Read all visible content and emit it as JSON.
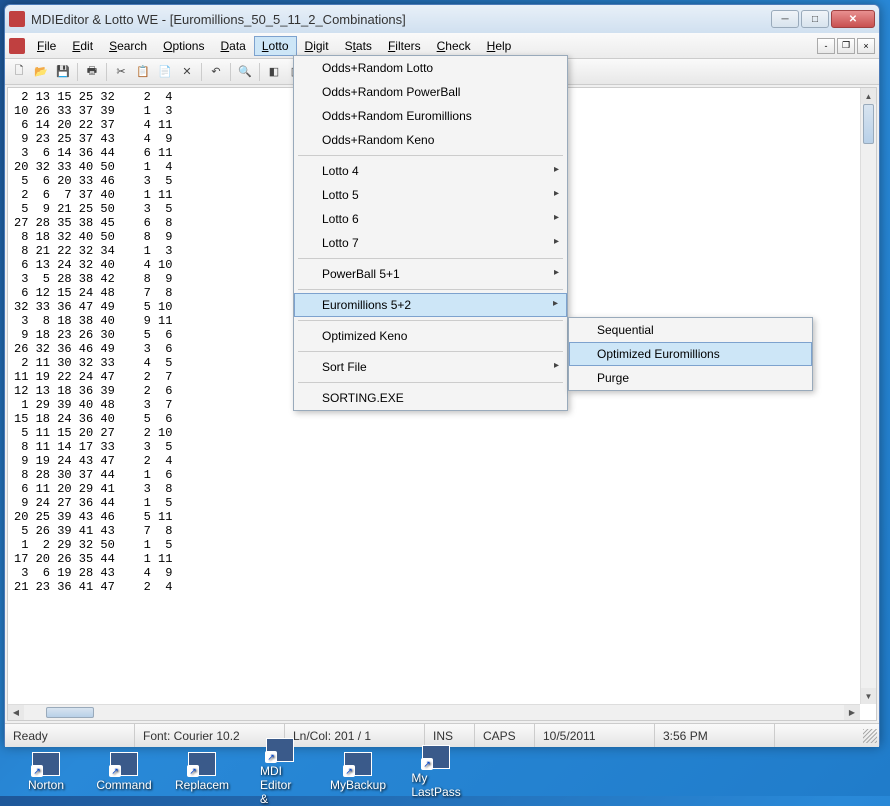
{
  "window": {
    "title": "MDIEditor & Lotto WE - [Euromillions_50_5_11_2_Combinations]"
  },
  "menubar": {
    "items": [
      "File",
      "Edit",
      "Search",
      "Options",
      "Data",
      "Lotto",
      "Digit",
      "Stats",
      "Filters",
      "Check",
      "Help"
    ],
    "active_index": 5
  },
  "dropdown_lotto": {
    "items": [
      {
        "label": "Odds+Random Lotto"
      },
      {
        "label": "Odds+Random PowerBall"
      },
      {
        "label": "Odds+Random Euromillions"
      },
      {
        "label": "Odds+Random Keno"
      },
      {
        "sep": true
      },
      {
        "label": "Lotto 4",
        "arrow": true
      },
      {
        "label": "Lotto 5",
        "arrow": true
      },
      {
        "label": "Lotto 6",
        "arrow": true
      },
      {
        "label": "Lotto 7",
        "arrow": true
      },
      {
        "sep": true
      },
      {
        "label": "PowerBall 5+1",
        "arrow": true
      },
      {
        "sep": true
      },
      {
        "label": "Euromillions 5+2",
        "arrow": true,
        "highlight": true
      },
      {
        "sep": true
      },
      {
        "label": "Optimized Keno"
      },
      {
        "sep": true
      },
      {
        "label": "Sort File",
        "arrow": true
      },
      {
        "sep": true
      },
      {
        "label": "SORTING.EXE"
      }
    ]
  },
  "submenu_euro": {
    "items": [
      {
        "label": "Sequential"
      },
      {
        "label": "Optimized Euromillions",
        "highlight": true
      },
      {
        "label": "Purge"
      }
    ]
  },
  "editor_rows": [
    " 2 13 15 25 32    2  4",
    "10 26 33 37 39    1  3",
    " 6 14 20 22 37    4 11",
    " 9 23 25 37 43    4  9",
    " 3  6 14 36 44    6 11",
    "20 32 33 40 50    1  4",
    " 5  6 20 33 46    3  5",
    " 2  6  7 37 40    1 11",
    " 5  9 21 25 50    3  5",
    "27 28 35 38 45    6  8",
    " 8 18 32 40 50    8  9",
    " 8 21 22 32 34    1  3",
    " 6 13 24 32 40    4 10",
    " 3  5 28 38 42    8  9",
    " 6 12 15 24 48    7  8",
    "32 33 36 47 49    5 10",
    " 3  8 18 38 40    9 11",
    " 9 18 23 26 30    5  6",
    "26 32 36 46 49    3  6",
    " 2 11 30 32 33    4  5",
    "11 19 22 24 47    2  7",
    "12 13 18 36 39    2  6",
    " 1 29 39 40 48    3  7",
    "15 18 24 36 40    5  6",
    " 5 11 15 20 27    2 10",
    " 8 11 14 17 33    3  5",
    " 9 19 24 43 47    2  4",
    " 8 28 30 37 44    1  6",
    " 6 11 20 29 41    3  8",
    " 9 24 27 36 44    1  5",
    "20 25 39 43 46    5 11",
    " 5 26 39 41 43    7  8",
    " 1  2 29 32 50    1  5",
    "17 20 26 35 44    1 11",
    " 3  6 19 28 43    4  9",
    "21 23 36 41 47    2  4"
  ],
  "statusbar": {
    "ready": "Ready",
    "font": "Font: Courier 10.2",
    "lncol": "Ln/Col: 201 / 1",
    "ins": "INS",
    "caps": "CAPS",
    "date": "10/5/2011",
    "time": "3:56 PM"
  },
  "taskbar": {
    "items": [
      "Norton",
      "Command",
      "Replacem",
      "MDI Editor &",
      "MyBackup",
      "My LastPass"
    ]
  }
}
